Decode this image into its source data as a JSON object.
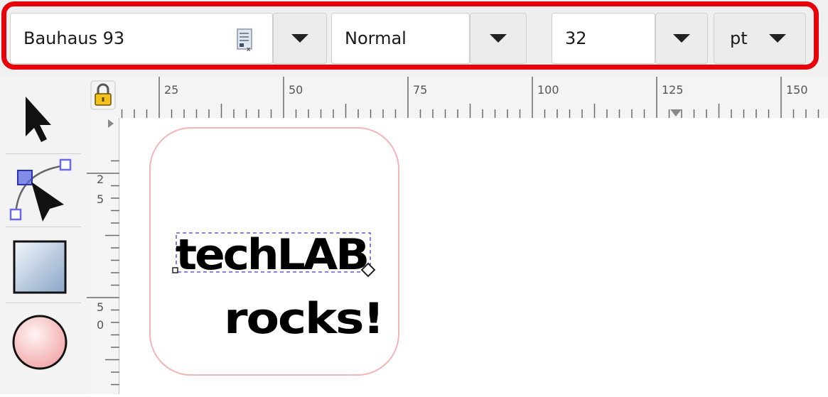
{
  "text_toolbar": {
    "font_family": "Bauhaus 93",
    "font_style": "Normal",
    "font_size": "32",
    "unit": "pt"
  },
  "ruler_top": {
    "labels": [
      "25",
      "50",
      "75",
      "100",
      "125",
      "150"
    ]
  },
  "ruler_left": {
    "labels": [
      {
        "d1": "2",
        "d2": "5"
      },
      {
        "d1": "5",
        "d2": "0"
      }
    ]
  },
  "canvas": {
    "text_line1": "techLAB",
    "text_line2": "rocks!"
  },
  "colors": {
    "highlight": "#e8000b",
    "page_border": "#f4b5b5",
    "selection": "#3a3ad0"
  },
  "tools": [
    "select-tool",
    "node-tool",
    "rectangle-tool",
    "ellipse-tool"
  ]
}
